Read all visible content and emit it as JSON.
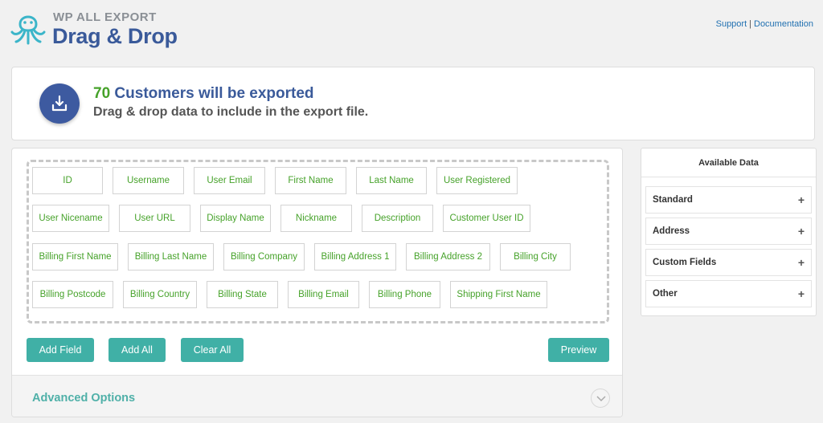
{
  "header": {
    "brand_small": "WP ALL EXPORT",
    "brand_big": "Drag & Drop",
    "links": {
      "support": "Support",
      "separator": "|",
      "documentation": "Documentation"
    }
  },
  "banner": {
    "count": "70",
    "line1_rest": " Customers will be exported",
    "line2": "Drag & drop data to include in the export file."
  },
  "fields": [
    "ID",
    "Username",
    "User Email",
    "First Name",
    "Last Name",
    "User Registered",
    "User Nicename",
    "User URL",
    "Display Name",
    "Nickname",
    "Description",
    "Customer User ID",
    "Billing First Name",
    "Billing Last Name",
    "Billing Company",
    "Billing Address 1",
    "Billing Address 2",
    "Billing City",
    "Billing Postcode",
    "Billing Country",
    "Billing State",
    "Billing Email",
    "Billing Phone",
    "Shipping First Name"
  ],
  "buttons": {
    "add_field": "Add Field",
    "add_all": "Add All",
    "clear_all": "Clear All",
    "preview": "Preview"
  },
  "advanced": {
    "label": "Advanced Options"
  },
  "sidebar": {
    "title": "Available Data",
    "items": [
      {
        "label": "Standard",
        "toggle": "+"
      },
      {
        "label": "Address",
        "toggle": "+"
      },
      {
        "label": "Custom Fields",
        "toggle": "+"
      },
      {
        "label": "Other",
        "toggle": "+"
      }
    ]
  },
  "colors": {
    "brand_blue": "#3a5a9a",
    "count_green": "#46a22a",
    "button_teal": "#40b0a6",
    "link_blue": "#2271b1"
  },
  "icons": {
    "logo": "octopus-logo-icon",
    "export": "download-tray-icon",
    "advanced_toggle": "chevron-down-icon"
  }
}
